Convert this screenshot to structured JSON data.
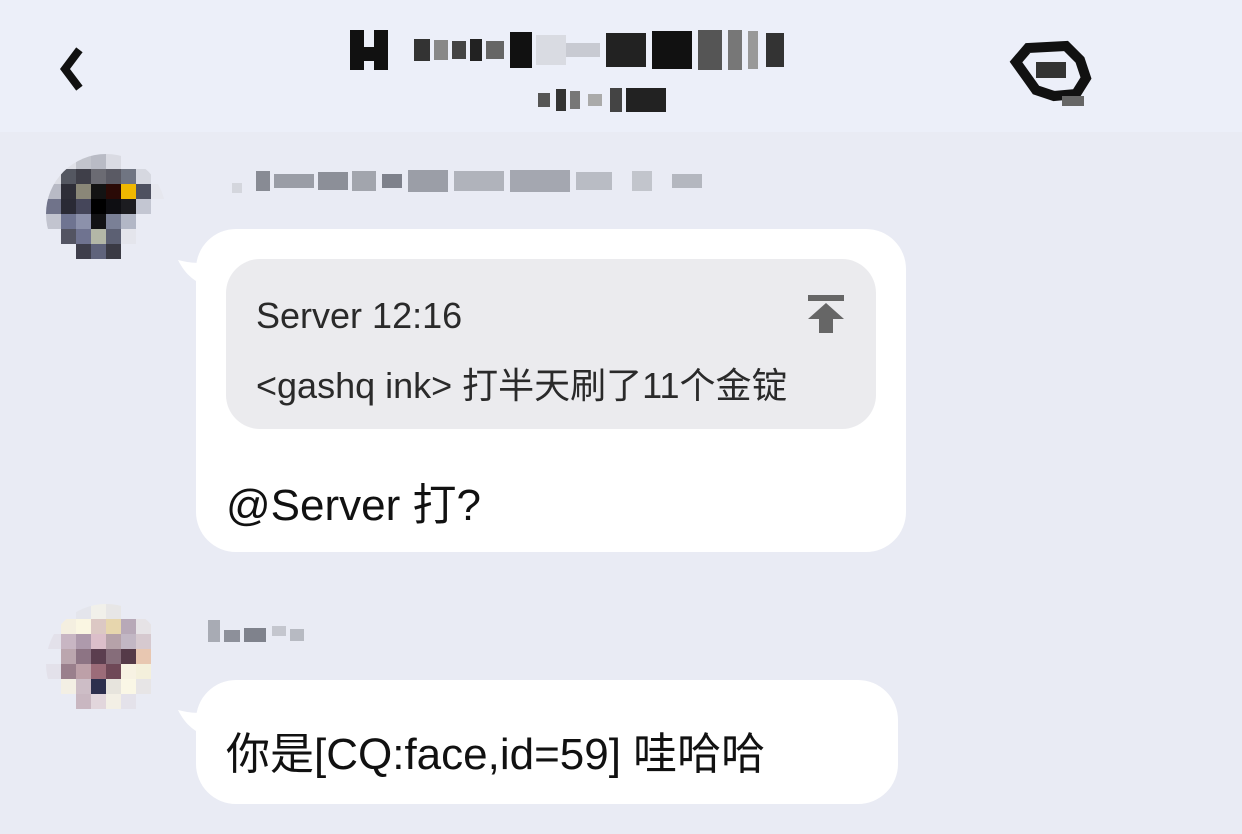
{
  "header": {
    "back_icon": "chevron-left-icon",
    "settings_icon": "group-settings-icon"
  },
  "messages": [
    {
      "quote": {
        "sender": "Server",
        "time": "12:16",
        "text": "<gashq ink> 打半天刷了11个金锭",
        "jump_icon": "jump-to-top-icon"
      },
      "text": "@Server 打?"
    },
    {
      "text": "你是[CQ:face,id=59] 哇哈哈"
    }
  ],
  "colors": {
    "background": "#e9ebf4",
    "header_background": "#eceff9",
    "bubble": "#ffffff",
    "quote_background": "#ebebee"
  }
}
